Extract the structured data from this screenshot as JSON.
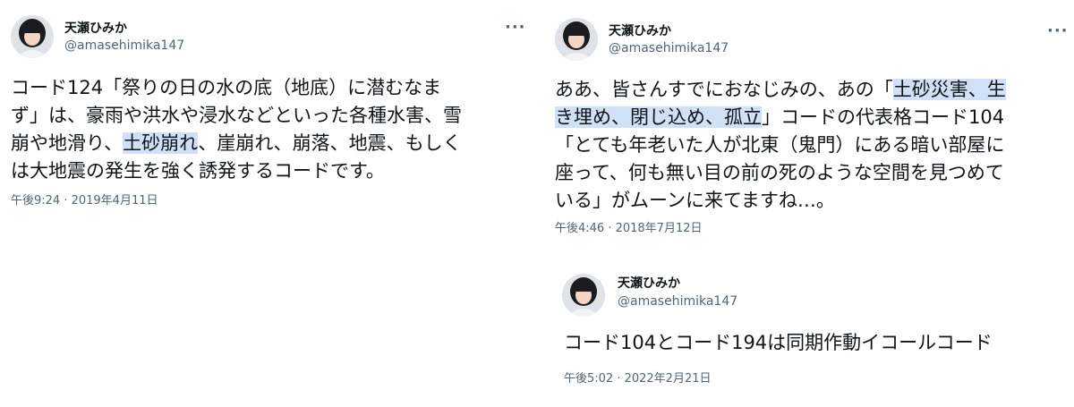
{
  "tweet1": {
    "name": "天瀬ひみか",
    "handle": "@amasehimika147",
    "more_icon": "more-dots-icon",
    "lines": [
      {
        "text": "コード124「祭りの日の水の底（地底）に潜むなま"
      },
      {
        "text": "ず」は、豪雨や洪水や浸水などといった各種水害、雪"
      },
      {
        "before": "崩や地滑り、",
        "highlight": "土砂崩れ",
        "after": "、崖崩れ、崩落、地震、もしく"
      },
      {
        "text": "は大地震の発生を強く誘発するコードです。"
      }
    ],
    "timestamp": "午後9:24 · 2019年4月11日"
  },
  "tweet2": {
    "name": "天瀬ひみか",
    "handle": "@amasehimika147",
    "more_icon": "more-dots-icon",
    "lines": [
      {
        "before": "ああ、皆さんすでにおなじみの、あの「",
        "highlight": "土砂災害、生",
        "after": ""
      },
      {
        "before": "",
        "highlight": "き埋め、閉じ込め、孤立",
        "after": "」コードの代表格コード104"
      },
      {
        "text": "「とても年老いた人が北東（鬼門）にある暗い部屋に"
      },
      {
        "text": "座って、何も無い目の前の死のような空間を見つめて"
      },
      {
        "text": "いる」がムーンに来てますね…。"
      }
    ],
    "timestamp": "午後4:46 · 2018年7月12日"
  },
  "tweet3": {
    "name": "天瀬ひみか",
    "handle": "@amasehimika147",
    "lines": [
      {
        "text": "コード104とコード194は同期作動イコールコード"
      }
    ],
    "timestamp": "午後5:02 · 2022年2月21日"
  },
  "colors": {
    "highlight": "#cfe0f7",
    "secondary_text": "#536471",
    "primary_text": "#0f1419"
  }
}
